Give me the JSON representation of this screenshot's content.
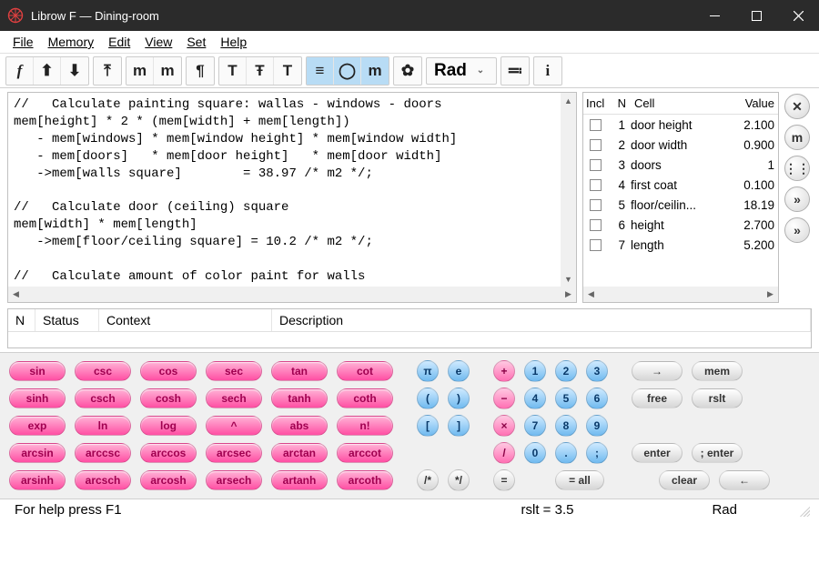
{
  "window": {
    "title": "Librow F — Dining-room"
  },
  "menu": {
    "items": [
      "File",
      "Memory",
      "Edit",
      "View",
      "Set",
      "Help"
    ]
  },
  "toolbar": {
    "angle_mode": "Rad"
  },
  "editor": {
    "text": "//   Calculate painting square: wallas - windows - doors\nmem[height] * 2 * (mem[width] + mem[length])\n   - mem[windows] * mem[window height] * mem[window width]\n   - mem[doors]   * mem[door height]   * mem[door width]\n   ->mem[walls square]        = 38.97 /* m2 */;\n\n//   Calculate door (ceiling) square\nmem[width] * mem[length]\n   ->mem[floor/ceiling square] = 10.2 /* m2 */;\n\n//   Calculate amount of color paint for walls\nmem[walls square] * (mem[first coat] + mem[second coat])"
  },
  "memory": {
    "cols": {
      "incl": "Incl",
      "n": "N",
      "cell": "Cell",
      "value": "Value"
    },
    "rows": [
      {
        "n": "1",
        "cell": "door height",
        "value": "2.100"
      },
      {
        "n": "2",
        "cell": "door width",
        "value": "0.900"
      },
      {
        "n": "3",
        "cell": "doors",
        "value": "1"
      },
      {
        "n": "4",
        "cell": "first coat",
        "value": "0.100"
      },
      {
        "n": "5",
        "cell": "floor/ceilin...",
        "value": "18.19"
      },
      {
        "n": "6",
        "cell": "height",
        "value": "2.700"
      },
      {
        "n": "7",
        "cell": "length",
        "value": "5.200"
      }
    ]
  },
  "diag": {
    "cols": {
      "n": "N",
      "status": "Status",
      "context": "Context",
      "desc": "Description"
    }
  },
  "keypad": {
    "trig": [
      [
        "sin",
        "csc",
        "cos",
        "sec",
        "tan",
        "cot"
      ],
      [
        "sinh",
        "csch",
        "cosh",
        "sech",
        "tanh",
        "coth"
      ],
      [
        "exp",
        "ln",
        "log",
        "^",
        "abs",
        "n!"
      ],
      [
        "arcsin",
        "arccsc",
        "arccos",
        "arcsec",
        "arctan",
        "arccot"
      ],
      [
        "arsinh",
        "arcsch",
        "arcosh",
        "arsech",
        "artanh",
        "arcoth"
      ]
    ],
    "consts": [
      [
        "π",
        "e"
      ],
      [
        "(",
        ")"
      ],
      [
        "[",
        "]"
      ],
      [
        "",
        ""
      ],
      [
        "/*",
        "*/"
      ]
    ],
    "ops": [
      "+",
      "−",
      "×",
      "/",
      "="
    ],
    "digits": [
      [
        "1",
        "2",
        "3"
      ],
      [
        "4",
        "5",
        "6"
      ],
      [
        "7",
        "8",
        "9"
      ],
      [
        "0",
        ".",
        ";"
      ],
      [
        "",
        "= all",
        ""
      ]
    ],
    "right": [
      [
        "→",
        "mem"
      ],
      [
        "free",
        "rslt"
      ],
      [
        "",
        ""
      ],
      [
        "enter",
        "; enter"
      ],
      [
        "clear",
        "←"
      ]
    ]
  },
  "status": {
    "help": "For help press F1",
    "result": "rslt = 3.5",
    "angle": "Rad"
  }
}
